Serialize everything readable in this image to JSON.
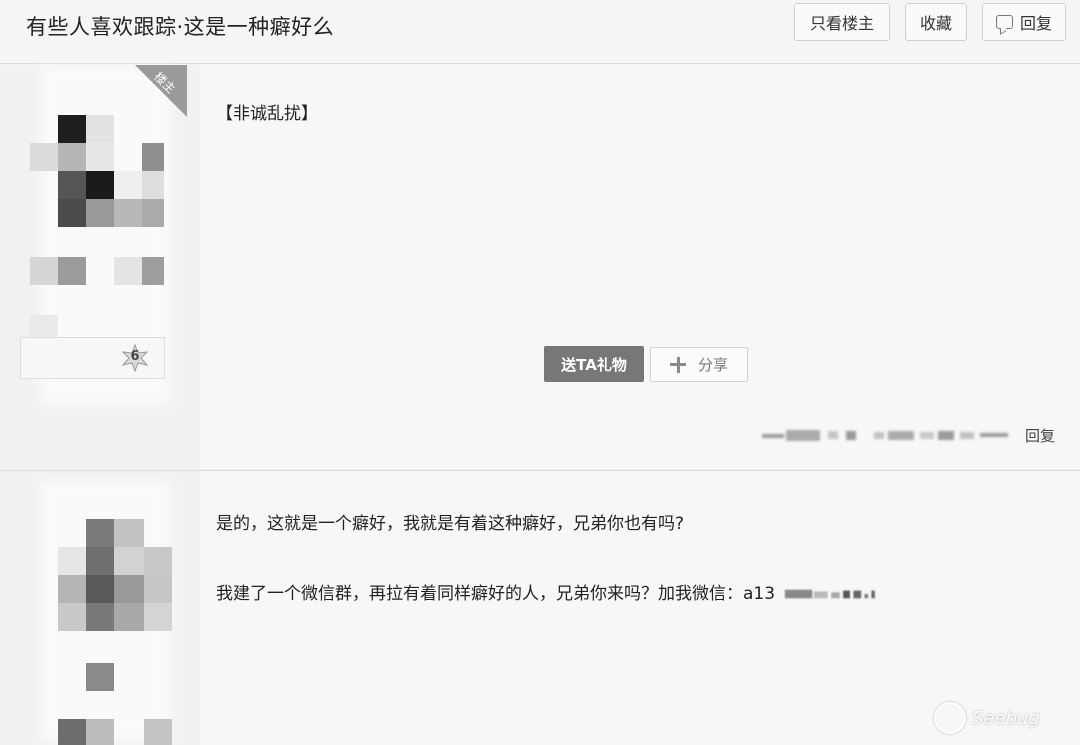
{
  "header": {
    "title": "有些人喜欢跟踪·这是一种癖好么",
    "only_op_label": "只看楼主",
    "favorite_label": "收藏",
    "reply_label": "回复"
  },
  "posts": [
    {
      "badge": "楼主",
      "level": "6",
      "text": "【非诚乱扰】",
      "gift_label": "送TA礼物",
      "share_label": "分享",
      "reply_label": "回复"
    },
    {
      "line1": "是的，这就是一个癖好，我就是有着这种癖好，兄弟你也有吗?",
      "line2": "我建了一个微信群，再拉有着同样癖好的人，兄弟你来吗？加我微信：a13"
    }
  ],
  "watermark": "Seebug",
  "colors": {
    "gift_button": "#777777",
    "badge": "#9a9a9a",
    "background": "#f4f4f4"
  }
}
